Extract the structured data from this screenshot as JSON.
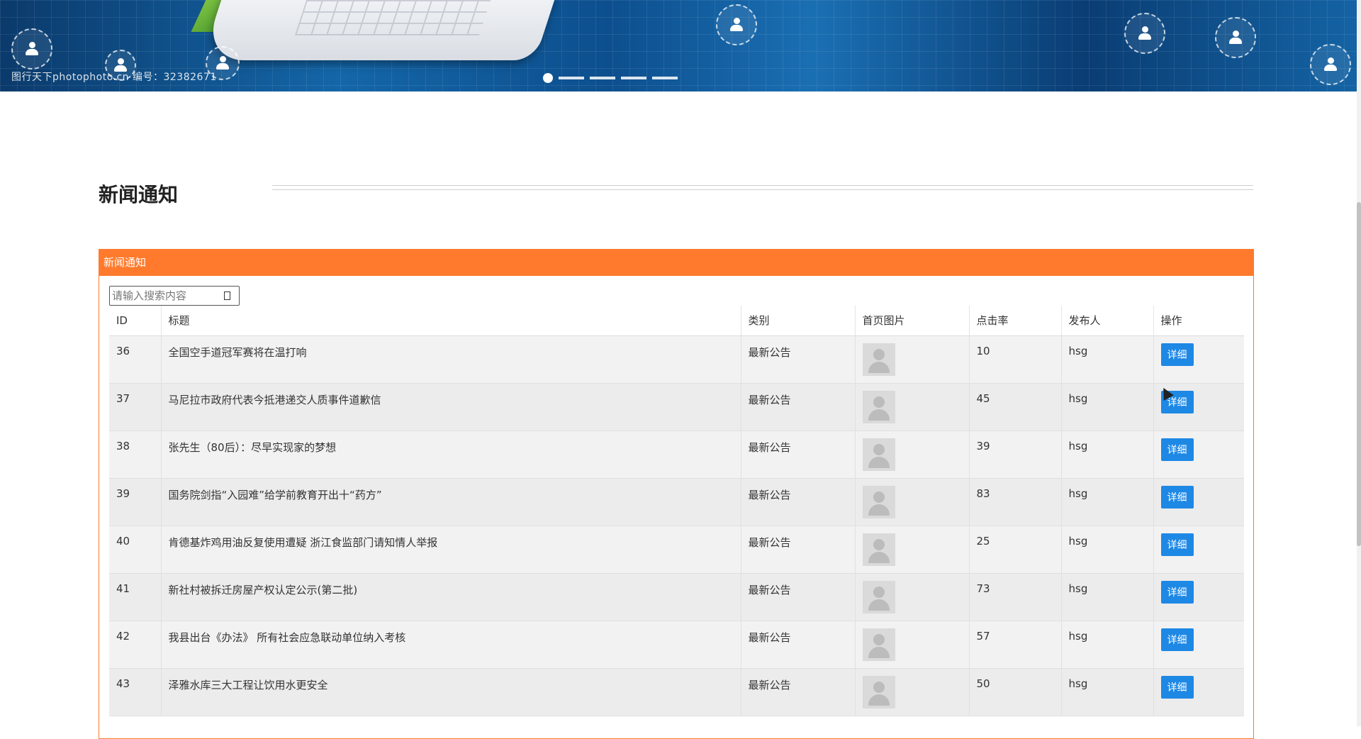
{
  "banner": {
    "watermark": "图行天下photophoto.cn  编号：32382671",
    "carousel_count": 5
  },
  "section": {
    "title": "新闻通知"
  },
  "panel": {
    "header": "新闻通知",
    "search_placeholder": "请输入搜索内容"
  },
  "table": {
    "columns": [
      "ID",
      "标题",
      "类别",
      "首页图片",
      "点击率",
      "发布人",
      "操作"
    ],
    "rows": [
      {
        "id": "36",
        "title": "全国空手道冠军赛将在温打响",
        "category": "最新公告",
        "clicks": "10",
        "publisher": "hsg",
        "action": "详细"
      },
      {
        "id": "37",
        "title": "马尼拉市政府代表今抵港递交人质事件道歉信",
        "category": "最新公告",
        "clicks": "45",
        "publisher": "hsg",
        "action": "详细"
      },
      {
        "id": "38",
        "title": "张先生（80后）：尽早实现家的梦想",
        "category": "最新公告",
        "clicks": "39",
        "publisher": "hsg",
        "action": "详细"
      },
      {
        "id": "39",
        "title": "国务院剑指“入园难”给学前教育开出十“药方”",
        "category": "最新公告",
        "clicks": "83",
        "publisher": "hsg",
        "action": "详细"
      },
      {
        "id": "40",
        "title": "肯德基炸鸡用油反复使用遭疑 浙江食监部门请知情人举报",
        "category": "最新公告",
        "clicks": "25",
        "publisher": "hsg",
        "action": "详细"
      },
      {
        "id": "41",
        "title": "新社村被拆迁房屋产权认定公示(第二批)",
        "category": "最新公告",
        "clicks": "73",
        "publisher": "hsg",
        "action": "详细"
      },
      {
        "id": "42",
        "title": "我县出台《办法》 所有社会应急联动单位纳入考核",
        "category": "最新公告",
        "clicks": "57",
        "publisher": "hsg",
        "action": "详细"
      },
      {
        "id": "43",
        "title": "泽雅水库三大工程让饮用水更安全",
        "category": "最新公告",
        "clicks": "50",
        "publisher": "hsg",
        "action": "详细"
      }
    ]
  },
  "colors": {
    "accent": "#ff7a2c",
    "button": "#1e88e5"
  }
}
